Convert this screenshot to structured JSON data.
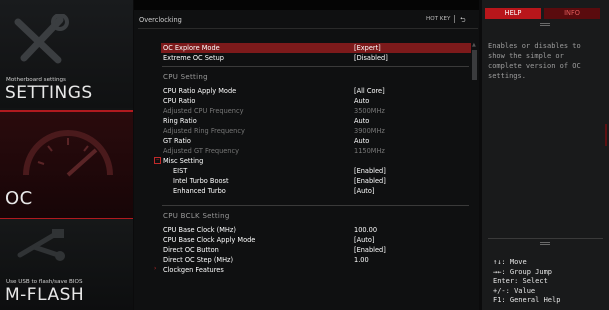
{
  "nav": {
    "settings": {
      "sub": "Motherboard settings",
      "title": "SETTINGS"
    },
    "oc": {
      "title": "OC"
    },
    "mflash": {
      "sub": "Use USB to flash/save BIOS",
      "title": "M-FLASH"
    }
  },
  "main": {
    "section_title": "Overclocking",
    "hotkey_label": "HOT KEY",
    "back_icon": "back-arrow-icon",
    "rows": [
      {
        "label": "OC Explore Mode",
        "value": "[Expert]"
      },
      {
        "label": "Extreme OC Setup",
        "value": "[Disabled]"
      },
      {
        "heading": "CPU  Setting"
      },
      {
        "label": "CPU Ratio Apply Mode",
        "value": "[All Core]"
      },
      {
        "label": "CPU Ratio",
        "value": "Auto"
      },
      {
        "label": "Adjusted CPU Frequency",
        "value": "3500MHz"
      },
      {
        "label": "Ring Ratio",
        "value": "Auto"
      },
      {
        "label": "Adjusted Ring Frequency",
        "value": "3900MHz"
      },
      {
        "label": "GT Ratio",
        "value": "Auto"
      },
      {
        "label": "Adjusted GT Frequency",
        "value": "1150MHz"
      },
      {
        "label": "Misc Setting"
      },
      {
        "label": "EIST",
        "value": "[Enabled]"
      },
      {
        "label": "Intel Turbo Boost",
        "value": "[Enabled]"
      },
      {
        "label": "Enhanced Turbo",
        "value": "[Auto]"
      },
      {
        "heading": "CPU  BCLK  Setting"
      },
      {
        "label": "CPU Base Clock (MHz)",
        "value": "100.00"
      },
      {
        "label": "CPU Base Clock Apply Mode",
        "value": "[Auto]"
      },
      {
        "label": "Direct OC Button",
        "value": "[Enabled]"
      },
      {
        "label": "Direct OC Step (MHz)",
        "value": "1.00"
      },
      {
        "label": "Clockgen Features"
      }
    ]
  },
  "help": {
    "tab_help": "HELP",
    "tab_info": "INFO",
    "text": "Enables or disables to show the simple or complete version of OC settings.",
    "keys": [
      "↑↓: Move",
      "→←: Group Jump",
      "Enter: Select",
      "+/-: Value",
      "F1: General Help"
    ]
  },
  "colors": {
    "accent_red": "#b8161b",
    "selected_row": "#7d1a1b",
    "dim_text": "#777777"
  }
}
